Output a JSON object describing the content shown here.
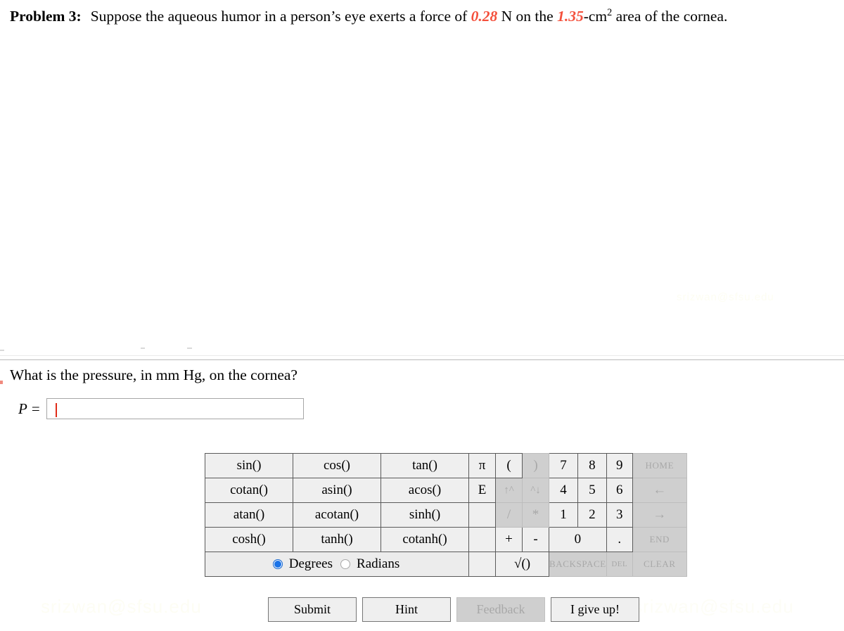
{
  "problem": {
    "label": "Problem 3:",
    "text_before_force": "Suppose the aqueous humor in a person’s eye exerts a force of",
    "force_value": "0.28",
    "text_mid": "N on the",
    "area_value": "1.35",
    "area_unit": "-cm",
    "area_exponent": "2",
    "text_after": "area of the cornea."
  },
  "question": {
    "text": "What is the pressure, in mm Hg, on the cornea?"
  },
  "answer": {
    "variable": "P",
    "equals": "=",
    "value": "",
    "placeholder": ""
  },
  "watermarks": {
    "email": "srizwan@sfsu.edu",
    "faint_top": "srizwan@sfsu.edu",
    "faint_bottom_right": "srizwan@sfsu.edu"
  },
  "calculator": {
    "functions": [
      [
        "sin()",
        "cos()",
        "tan()"
      ],
      [
        "cotan()",
        "asin()",
        "acos()"
      ],
      [
        "atan()",
        "acotan()",
        "sinh()"
      ],
      [
        "cosh()",
        "tanh()",
        "cotanh()"
      ]
    ],
    "mode": {
      "degrees_label": "Degrees",
      "radians_label": "Radians",
      "selected": "Degrees"
    },
    "constants": [
      "π",
      "E",
      "",
      "",
      ""
    ],
    "paren_open": "(",
    "paren_close": ")",
    "power_up": "↑^",
    "power_down": "^↓",
    "divide": "/",
    "multiply": "*",
    "plus": "+",
    "minus": "-",
    "sqrt": "√()",
    "numbers": {
      "row1": [
        "7",
        "8",
        "9"
      ],
      "row2": [
        "4",
        "5",
        "6"
      ],
      "row3": [
        "1",
        "2",
        "3"
      ],
      "zero": "0",
      "decimal": "."
    },
    "nav": {
      "home": "HOME",
      "left": "←",
      "right": "→",
      "end": "END",
      "clear": "CLEAR"
    },
    "edit": {
      "backspace": "BACKSPACE",
      "del": "DEL"
    }
  },
  "actions": {
    "submit": "Submit",
    "hint": "Hint",
    "feedback": "Feedback",
    "give_up": "I give up!"
  },
  "colors": {
    "value_red": "#f4503c",
    "caret_red": "#e02b18",
    "radio_blue": "#1a73e8",
    "button_face": "#efefef",
    "button_disabled": "#cfcfcf"
  }
}
